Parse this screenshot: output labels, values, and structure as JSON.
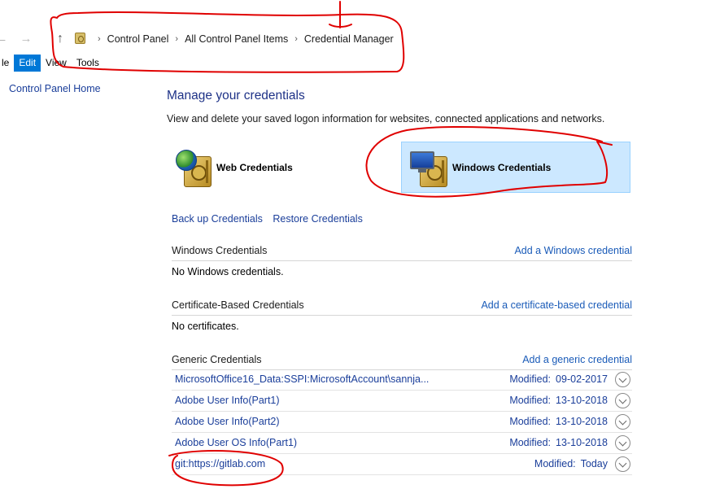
{
  "address_bar": {
    "back_glyph": "←",
    "forward_glyph": "→",
    "up_glyph": "↑",
    "breadcrumb": [
      "Control Panel",
      "All Control Panel Items",
      "Credential Manager"
    ],
    "separator": "›"
  },
  "menu": [
    "le",
    "Edit",
    "View",
    "Tools"
  ],
  "sidebar": {
    "home_link": "Control Panel Home"
  },
  "main": {
    "title": "Manage your credentials",
    "subtitle": "View and delete your saved logon information for websites, connected applications and networks.",
    "tiles": [
      {
        "label": "Web Credentials",
        "icon": "web-credentials-icon"
      },
      {
        "label": "Windows Credentials",
        "icon": "windows-credentials-icon",
        "selected": true
      }
    ],
    "backup_link": "Back up Credentials",
    "restore_link": "Restore Credentials",
    "sections": [
      {
        "heading": "Windows Credentials",
        "add_link": "Add a Windows credential",
        "empty_text": "No Windows credentials."
      },
      {
        "heading": "Certificate-Based Credentials",
        "add_link": "Add a certificate-based credential",
        "empty_text": "No certificates."
      },
      {
        "heading": "Generic Credentials",
        "add_link": "Add a generic credential"
      }
    ],
    "modified_label": "Modified:",
    "generic_items": [
      {
        "name": "MicrosoftOffice16_Data:SSPI:MicrosoftAccount\\sannja...",
        "modified": "09-02-2017"
      },
      {
        "name": "Adobe User Info(Part1)",
        "modified": "13-10-2018"
      },
      {
        "name": "Adobe User Info(Part2)",
        "modified": "13-10-2018"
      },
      {
        "name": "Adobe User OS Info(Part1)",
        "modified": "13-10-2018"
      },
      {
        "name": "git:https://gitlab.com",
        "modified": "Today"
      }
    ]
  },
  "colors": {
    "accent": "#0078d7",
    "link": "#1a3e9a",
    "title": "#1e3287",
    "selected_tile": "#cce8ff",
    "annotation": "#e00000"
  }
}
